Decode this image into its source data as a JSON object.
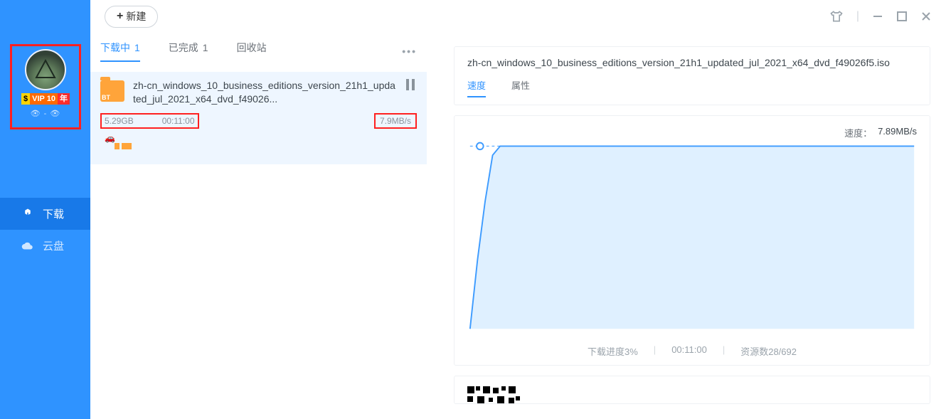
{
  "sidebar": {
    "vip_badge": {
      "s": "$",
      "v": "VIP 10",
      "y": "年"
    },
    "eyes": "👁 - 👁",
    "items": [
      {
        "icon": "download",
        "label": "下载",
        "active": true
      },
      {
        "icon": "cloud",
        "label": "云盘",
        "active": false
      }
    ]
  },
  "topbar": {
    "new_label": "新建"
  },
  "tabs": [
    {
      "label": "下载中",
      "count": "1",
      "active": true
    },
    {
      "label": "已完成",
      "count": "1",
      "active": false
    },
    {
      "label": "回收站",
      "count": "",
      "active": false
    }
  ],
  "task": {
    "folder_tag": "BT",
    "name": "zh-cn_windows_10_business_editions_version_21h1_updated_jul_2021_x64_dvd_f49026...",
    "size": "5.29GB",
    "eta": "00:11:00",
    "speed": "7.9MB/s"
  },
  "detail": {
    "filename": "zh-cn_windows_10_business_editions_version_21h1_updated_jul_2021_x64_dvd_f49026f5.iso",
    "sub_tabs": [
      {
        "label": "速度",
        "active": true
      },
      {
        "label": "属性",
        "active": false
      }
    ],
    "speed_label": "速度：",
    "speed_value": "7.89MB/s",
    "footer": {
      "progress": "下载进度3%",
      "eta": "00:11:00",
      "sources": "资源数28/692"
    }
  },
  "chart_data": {
    "type": "line",
    "title": "",
    "xlabel": "",
    "ylabel": "",
    "ylim": [
      0,
      8
    ],
    "x": [
      0,
      1,
      2,
      3,
      4,
      5,
      6,
      7,
      8,
      9,
      10,
      11,
      12,
      13,
      14,
      15,
      16,
      17,
      18,
      19,
      20,
      21,
      22,
      23,
      24,
      25,
      26,
      27,
      28,
      29,
      30,
      31,
      32,
      33,
      34,
      35,
      36,
      37,
      38,
      39,
      40,
      41,
      42,
      43,
      44,
      45,
      46,
      47,
      48,
      49,
      50,
      51,
      52,
      53,
      54,
      55,
      56,
      57,
      58,
      59
    ],
    "series": [
      {
        "name": "speed_MBps",
        "values": [
          0,
          3,
          5.5,
          7.5,
          7.89,
          7.89,
          7.89,
          7.89,
          7.89,
          7.89,
          7.89,
          7.89,
          7.89,
          7.89,
          7.89,
          7.89,
          7.89,
          7.89,
          7.89,
          7.89,
          7.89,
          7.89,
          7.89,
          7.89,
          7.89,
          7.89,
          7.89,
          7.89,
          7.89,
          7.89,
          7.89,
          7.89,
          7.89,
          7.89,
          7.89,
          7.89,
          7.89,
          7.89,
          7.89,
          7.89,
          7.89,
          7.89,
          7.89,
          7.89,
          7.89,
          7.89,
          7.89,
          7.89,
          7.89,
          7.89,
          7.89,
          7.89,
          7.89,
          7.89,
          7.89,
          7.89,
          7.89,
          7.89,
          7.89,
          7.89
        ]
      }
    ],
    "current_point": {
      "x": 0.6,
      "y": 7.89
    }
  }
}
